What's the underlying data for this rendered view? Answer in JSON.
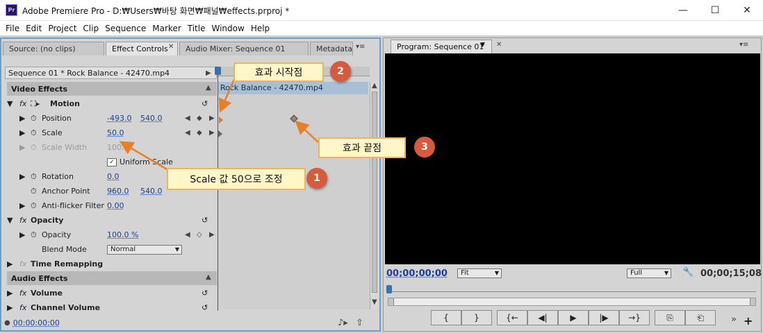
{
  "window": {
    "app_icon": "Pr",
    "title": "Adobe Premiere Pro - D:₩Users₩바탕 화면₩패널₩effects.prproj *",
    "minimize": "—",
    "maximize": "☐",
    "close": "✕"
  },
  "menu": [
    "File",
    "Edit",
    "Project",
    "Clip",
    "Sequence",
    "Marker",
    "Title",
    "Window",
    "Help"
  ],
  "left_tabs": {
    "source": "Source: (no clips)",
    "effect_controls": "Effect Controls",
    "audio_mixer": "Audio Mixer: Sequence 01",
    "metadata": "Metadata"
  },
  "effect_controls": {
    "sequence_label": "Sequence 01 * Rock Balance - 42470.mp4",
    "clip_bar": "Rock Balance - 42470.mp4",
    "video_effects": "Video Effects",
    "motion": "Motion",
    "position": {
      "label": "Position",
      "x": "-493.0",
      "y": "540.0"
    },
    "scale": {
      "label": "Scale",
      "value": "50.0"
    },
    "scale_width": {
      "label": "Scale Width",
      "value": "100.0"
    },
    "uniform_scale": "Uniform Scale",
    "rotation": {
      "label": "Rotation",
      "value": "0.0"
    },
    "anchor_point": {
      "label": "Anchor Point",
      "x": "960.0",
      "y": "540.0"
    },
    "anti_flicker": {
      "label": "Anti-flicker Filter",
      "value": "0.00"
    },
    "opacity_group": "Opacity",
    "opacity": {
      "label": "Opacity",
      "value": "100.0 %"
    },
    "blend_mode": {
      "label": "Blend Mode",
      "value": "Normal"
    },
    "time_remapping": "Time Remapping",
    "audio_effects": "Audio Effects",
    "volume": "Volume",
    "channel_volume": "Channel Volume",
    "timecode": "00:00:00:00"
  },
  "program": {
    "tab": "Program: Sequence 01",
    "timecode_left": "00;00;00;00",
    "fit": "Fit",
    "full": "Full",
    "timecode_right": "00;00;15;08"
  },
  "callouts": {
    "c1": {
      "text": "Scale 값 50으로 조정",
      "num": "1"
    },
    "c2": {
      "text": "효과 시작점",
      "num": "2"
    },
    "c3": {
      "text": "효과 끝점",
      "num": "3"
    }
  },
  "transport": [
    "{",
    "}",
    "{←",
    "◀|",
    "▶",
    "|▶",
    "→}",
    "⎘",
    "⎗"
  ],
  "colors": {
    "accent": "#6a9fc8",
    "callout_border": "#f2b25a",
    "badge": "#d65a3c",
    "playhead": "#d02020"
  }
}
